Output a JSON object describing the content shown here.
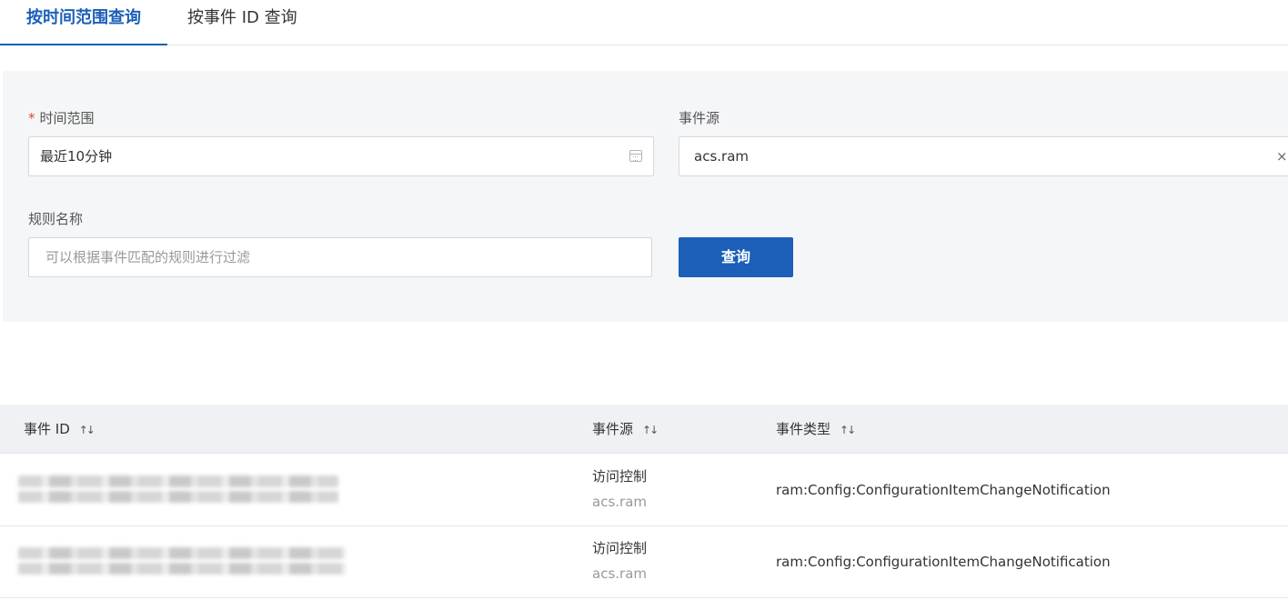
{
  "tabs": [
    {
      "label": "按时间范围查询",
      "active": true
    },
    {
      "label": "按事件 ID 查询",
      "active": false
    }
  ],
  "filters": {
    "time_range": {
      "required_mark": "*",
      "label": "时间范围",
      "value": "最近10分钟",
      "icon": "calendar-icon"
    },
    "event_source": {
      "label": "事件源",
      "value": "acs.ram",
      "clear_icon": "×"
    },
    "rule_name": {
      "label": "规则名称",
      "placeholder": "可以根据事件匹配的规则进行过滤",
      "value": ""
    },
    "query_button": "查询"
  },
  "table": {
    "columns": [
      {
        "label": "事件 ID",
        "sort_icon": "↑↓"
      },
      {
        "label": "事件源",
        "sort_icon": "↑↓"
      },
      {
        "label": "事件类型",
        "sort_icon": "↑↓"
      }
    ],
    "rows": [
      {
        "event_id": "",
        "source_name": "访问控制",
        "source_code": "acs.ram",
        "event_type": "ram:Config:ConfigurationItemChangeNotification"
      },
      {
        "event_id": "",
        "source_name": "访问控制",
        "source_code": "acs.ram",
        "event_type": "ram:Config:ConfigurationItemChangeNotification"
      }
    ]
  },
  "colors": {
    "accent": "#1b5fb8",
    "required": "#e8432d",
    "panel_bg": "#f5f6f8",
    "header_bg": "#eff1f5"
  }
}
